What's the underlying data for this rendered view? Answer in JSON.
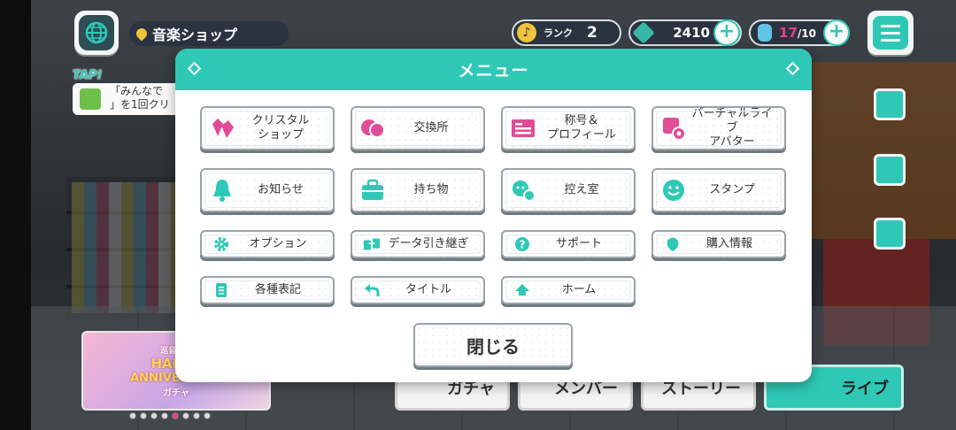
{
  "location": {
    "name": "音楽ショップ"
  },
  "tap_hint": {
    "tap_text": "TAP!",
    "mission_line1": "「みんなで",
    "mission_line2": "」を1回クリ"
  },
  "hud": {
    "rank_label": "ランク",
    "rank_value": "2",
    "gems": "2410",
    "energy_current": "17",
    "energy_max": "/10"
  },
  "menu": {
    "title": "メニュー",
    "items": [
      {
        "label": "クリスタル\nショップ",
        "icon": "crystal-icon"
      },
      {
        "label": "交換所",
        "icon": "exchange-icon"
      },
      {
        "label": "称号＆\nプロフィール",
        "icon": "profile-card-icon"
      },
      {
        "label": "バーチャルライブ\nアバター",
        "icon": "avatar-gear-icon"
      },
      {
        "label": "お知らせ",
        "icon": "bell-icon"
      },
      {
        "label": "持ち物",
        "icon": "bag-icon"
      },
      {
        "label": "控え室",
        "icon": "waiting-room-icon"
      },
      {
        "label": "スタンプ",
        "icon": "smile-stamp-icon"
      },
      {
        "label": "オプション",
        "icon": "gear-icon"
      },
      {
        "label": "データ引き継ぎ",
        "icon": "data-transfer-icon"
      },
      {
        "label": "サポート",
        "icon": "question-icon"
      },
      {
        "label": "購入情報",
        "icon": "purchase-info-icon"
      },
      {
        "label": "各種表記",
        "icon": "document-list-icon"
      },
      {
        "label": "タイトル",
        "icon": "return-arrow-icon"
      },
      {
        "label": "ホーム",
        "icon": "home-icon"
      }
    ],
    "close_label": "閉じる"
  },
  "bottom_nav": {
    "gacha": "ガチャ",
    "member": "メンバー",
    "story": "ストーリー",
    "live": "ライブ"
  },
  "banner": {
    "line1": "巡音ルカ",
    "line2": "HAPPY",
    "line3": "ANNIVERSARY",
    "line4": "ガチャ"
  },
  "colors": {
    "accent": "#2fc8b6",
    "dark_pill": "#2b3340",
    "energy_current": "#e5418a"
  }
}
